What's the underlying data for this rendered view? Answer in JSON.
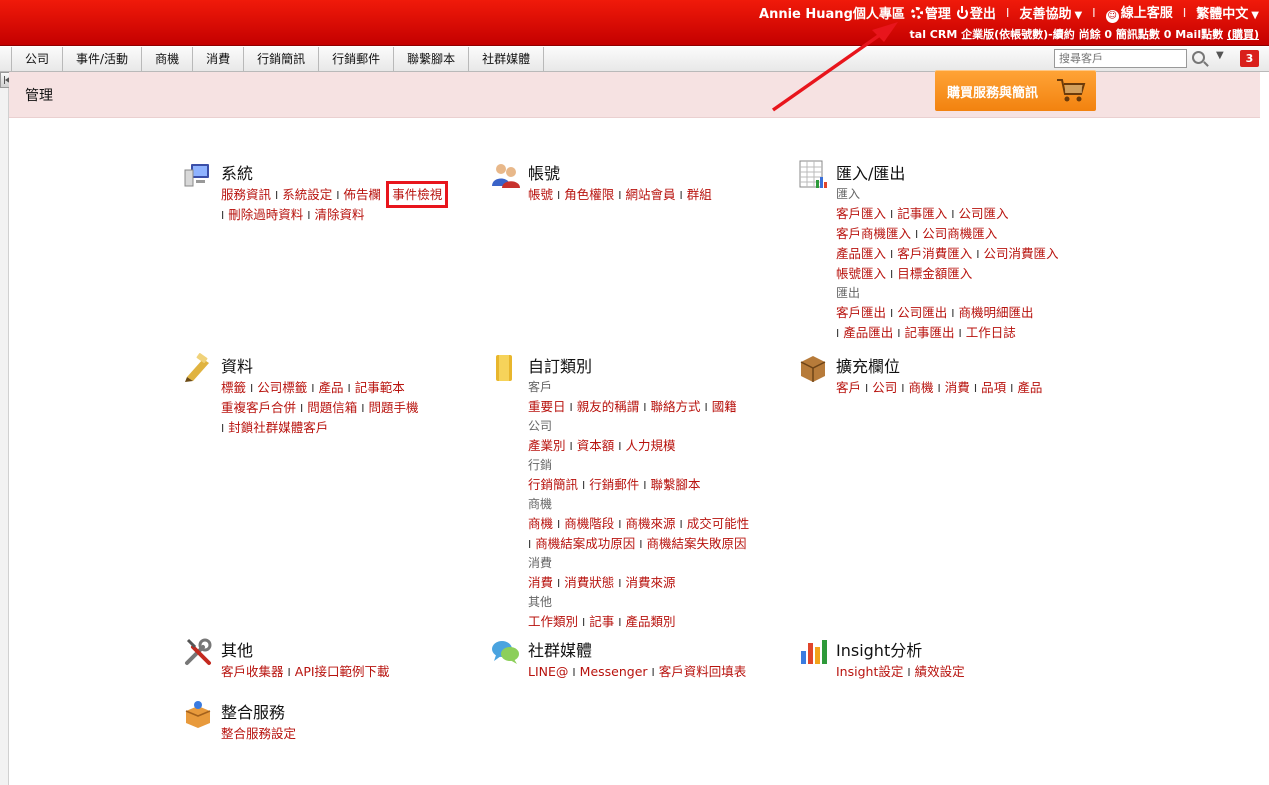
{
  "topbar": {
    "user": "Annie Huang個人專區",
    "admin": "管理",
    "logout": "登出",
    "help": "友善協助",
    "support": "線上客服",
    "language": "繁體中文",
    "plan_text": "tal CRM 企業版(依帳號數)-續約  尚餘 0 簡訊點數 0 Mail點數 ",
    "buy_link": "(購買)",
    "separator": "I"
  },
  "nav": {
    "tabs": [
      "公司",
      "事件/活動",
      "商機",
      "消費",
      "行銷簡訊",
      "行銷郵件",
      "聯繫腳本",
      "社群媒體"
    ],
    "search_placeholder": "搜尋客戶",
    "notification_count": "3"
  },
  "page": {
    "title": "管理",
    "buy_button": "購買服務與簡訊"
  },
  "sections": {
    "system": {
      "title": "系統",
      "links": [
        "服務資訊",
        "系統設定",
        "佈告欄",
        "事件檢視",
        "刪除過時資料",
        "清除資料"
      ]
    },
    "account": {
      "title": "帳號",
      "links": [
        "帳號",
        "角色權限",
        "網站會員",
        "群組"
      ]
    },
    "import_export": {
      "title": "匯入/匯出",
      "import_label": "匯入",
      "import_links": [
        "客戶匯入",
        "記事匯入",
        "公司匯入",
        "客戶商機匯入",
        "公司商機匯入",
        "產品匯入",
        "客戶消費匯入",
        "公司消費匯入",
        "帳號匯入",
        "目標金額匯入"
      ],
      "export_label": "匯出",
      "export_links": [
        "客戶匯出",
        "公司匯出",
        "商機明細匯出",
        "產品匯出",
        "記事匯出",
        "工作日誌"
      ]
    },
    "data": {
      "title": "資料",
      "links": [
        "標籤",
        "公司標籤",
        "產品",
        "記事範本",
        "重複客戶合併",
        "問題信箱",
        "問題手機",
        "封鎖社群媒體客戶"
      ]
    },
    "custom": {
      "title": "自訂類別",
      "groups": [
        {
          "label": "客戶",
          "links": [
            "重要日",
            "親友的稱謂",
            "聯絡方式",
            "國籍"
          ]
        },
        {
          "label": "公司",
          "links": [
            "產業別",
            "資本額",
            "人力規模"
          ]
        },
        {
          "label": "行銷",
          "links": [
            "行銷簡訊",
            "行銷郵件",
            "聯繫腳本"
          ]
        },
        {
          "label": "商機",
          "links": [
            "商機",
            "商機階段",
            "商機來源",
            "成交可能性",
            "商機結案成功原因",
            "商機結案失敗原因"
          ]
        },
        {
          "label": "消費",
          "links": [
            "消費",
            "消費狀態",
            "消費來源"
          ]
        },
        {
          "label": "其他",
          "links": [
            "工作類別",
            "記事",
            "產品類別"
          ]
        }
      ]
    },
    "extend": {
      "title": "擴充欄位",
      "links": [
        "客戶",
        "公司",
        "商機",
        "消費",
        "品項",
        "產品"
      ]
    },
    "other": {
      "title": "其他",
      "links": [
        "客戶收集器",
        "API接口範例下載"
      ]
    },
    "social": {
      "title": "社群媒體",
      "links": [
        "LINE@",
        "Messenger",
        "客戶資料回填表"
      ]
    },
    "insight": {
      "title": "Insight分析",
      "links": [
        "Insight設定",
        "績效設定"
      ]
    },
    "integration": {
      "title": "整合服務",
      "links": [
        "整合服務設定"
      ]
    }
  },
  "colors": {
    "topbar": "#d40b05",
    "link": "#b8130e",
    "header_band": "#f6e2e2",
    "buy_button": "#f79125",
    "highlight": "#e8151c"
  }
}
